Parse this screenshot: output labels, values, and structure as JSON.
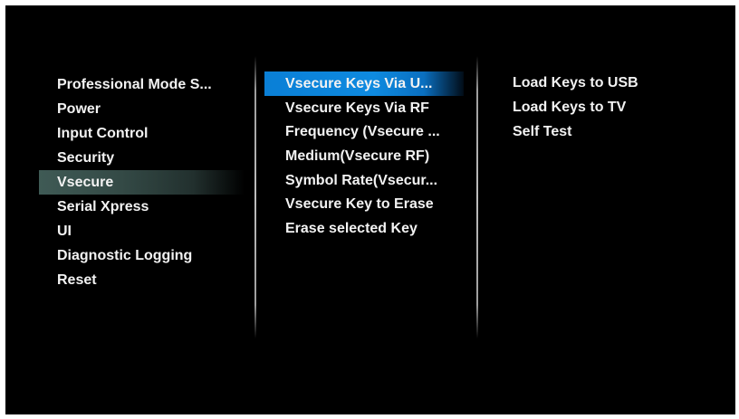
{
  "main_menu": {
    "items": [
      {
        "label": "Professional Mode S..."
      },
      {
        "label": "Power"
      },
      {
        "label": "Input Control"
      },
      {
        "label": "Security"
      },
      {
        "label": "Vsecure",
        "selected": true
      },
      {
        "label": "Serial Xpress"
      },
      {
        "label": "UI"
      },
      {
        "label": "Diagnostic Logging"
      },
      {
        "label": "Reset"
      }
    ]
  },
  "vsecure_menu": {
    "items": [
      {
        "label": "Vsecure Keys Via U...",
        "focused": true
      },
      {
        "label": "Vsecure Keys Via RF"
      },
      {
        "label": "Frequency (Vsecure ..."
      },
      {
        "label": "Medium(Vsecure RF)"
      },
      {
        "label": "Symbol Rate(Vsecur..."
      },
      {
        "label": "Vsecure Key to Erase"
      },
      {
        "label": "Erase selected Key"
      }
    ]
  },
  "usb_submenu": {
    "items": [
      {
        "label": "Load Keys to USB"
      },
      {
        "label": "Load Keys to TV"
      },
      {
        "label": "Self Test"
      }
    ]
  },
  "colors": {
    "background": "#000000",
    "text": "#f2f2f2",
    "focus_highlight": "#0e8ae0",
    "selected_highlight": "#3f5a55"
  }
}
